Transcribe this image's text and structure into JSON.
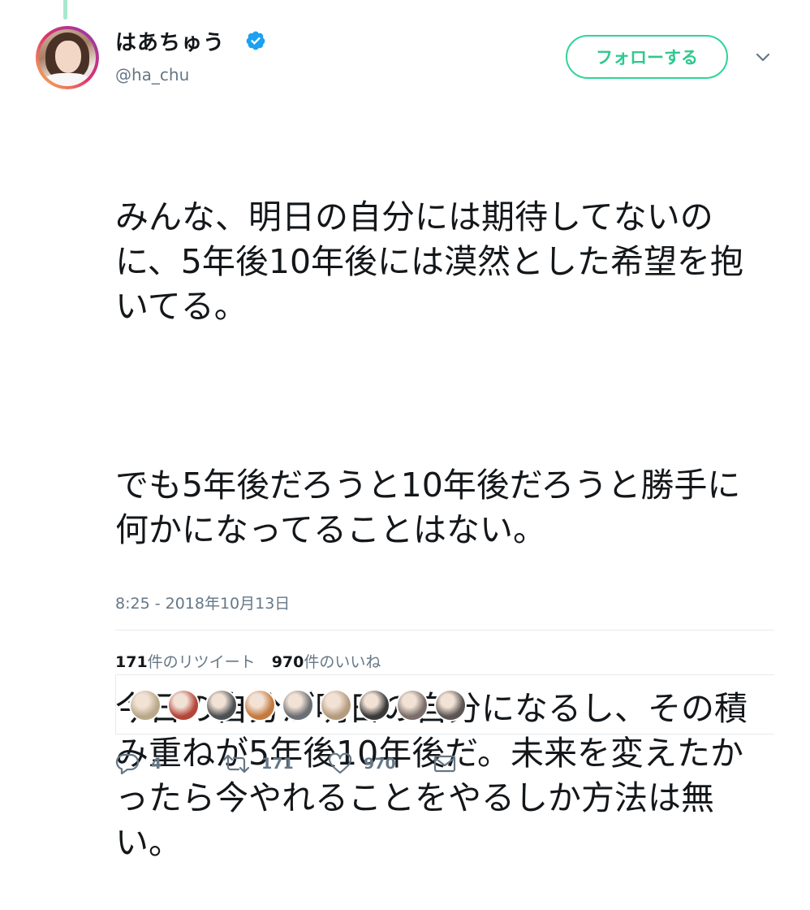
{
  "author": {
    "display_name": "はあちゅう",
    "handle": "@ha_chu",
    "verified": true,
    "avatar_icon": "avatar-photo"
  },
  "header": {
    "follow_label": "フォローする",
    "more_icon": "chevron-down-icon"
  },
  "tweet": {
    "paragraphs": [
      "みんな、明日の自分には期待してないのに、5年後10年後には漠然とした希望を抱いてる。",
      "でも5年後だろうと10年後だろうと勝手に何かになってることはない。",
      "今日の自分が明日の自分になるし、その積み重ねが5年後10年後だ。未来を変えたかったら今やれることをやるしか方法は無い。"
    ],
    "timestamp": "8:25 - 2018年10月13日"
  },
  "stats": {
    "retweets_count": "171",
    "retweets_label": "件のリツイート",
    "likes_count": "970",
    "likes_label": "件のいいね"
  },
  "likers": [
    {
      "color": "#b9a98a"
    },
    {
      "color": "#b4453a"
    },
    {
      "color": "#4d5052"
    },
    {
      "color": "#c47a3f"
    },
    {
      "color": "#6b6f73"
    },
    {
      "color": "#b59b7e"
    },
    {
      "color": "#3a3a3a"
    },
    {
      "color": "#7b6e6a"
    },
    {
      "color": "#5a5552"
    }
  ],
  "actions": {
    "reply_count": "4",
    "retweet_count": "171",
    "like_count": "970",
    "reply_icon": "reply-icon",
    "retweet_icon": "retweet-icon",
    "like_icon": "heart-icon",
    "dm_icon": "envelope-icon"
  },
  "colors": {
    "follow_green": "#2fd596",
    "verified_blue": "#1da1f2",
    "muted_gray": "#657786"
  }
}
